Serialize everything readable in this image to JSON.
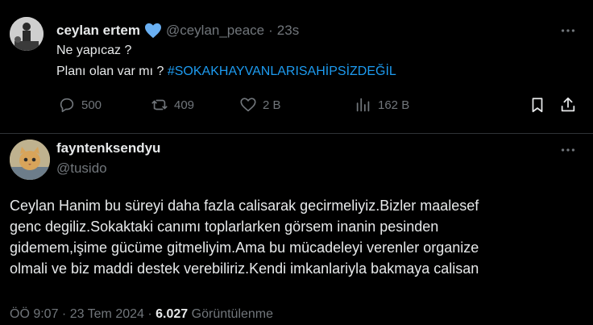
{
  "tweet": {
    "author_name": "ceylan ertem",
    "handle": "@ceylan_peace",
    "separator": "·",
    "time": "23s",
    "line1": "Ne yapıcaz ?",
    "line2": "Planı olan var mı ?",
    "hashtag": "#SOKAKHAYVANLARISAHİPSİZDEĞİL",
    "actions": {
      "replies": "500",
      "reposts": "409",
      "likes": "2 B",
      "views": "162 B"
    }
  },
  "reply": {
    "author_name": "fayntenksendyu",
    "handle": "@tusido",
    "lines": [
      "Ceylan Hanim bu süreyi daha fazla calisarak gecirmeliyiz.Bizler maalesef",
      "genc degiliz.Sokaktaki canımı toplarlarken görsem inanin pesinden",
      "gidemem,işime gücüme gitmeliyim.Ama bu mücadeleyi verenler organize",
      "olmali ve biz maddi destek verebiliriz.Kendi imkanlariyla bakmaya calisan"
    ],
    "timestamp": "ÖÖ 9:07 · 23 Tem 2024 ·",
    "views_count": "6.027",
    "views_label": "Görüntülenme"
  },
  "colors": {
    "background": "#000000",
    "text": "#e7e9ea",
    "muted": "#71767b",
    "accent": "#1d9bf0",
    "verified_heart": "#6ab0f3"
  },
  "icons": [
    "blue-heart-icon",
    "reply-icon",
    "repost-icon",
    "like-icon",
    "views-icon",
    "bookmark-icon",
    "share-icon",
    "more-icon"
  ]
}
